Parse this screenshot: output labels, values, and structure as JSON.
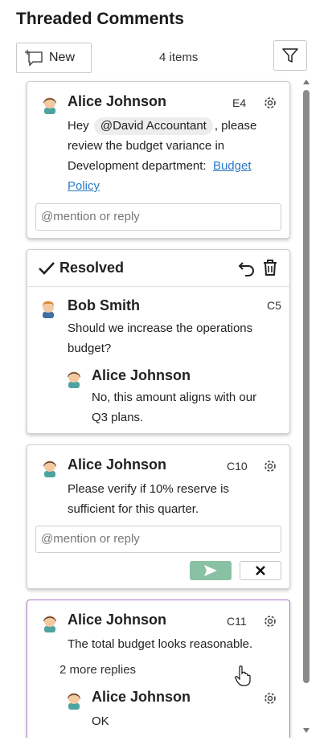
{
  "panel": {
    "title": "Threaded Comments",
    "new_label": "New",
    "item_count": "4 items"
  },
  "threads": [
    {
      "author": "Alice Johnson",
      "cell": "E4",
      "text_before": "Hey",
      "mention": "@David Accountant",
      "text_after_1": ", please",
      "text_line2": "review the budget variance in",
      "text_line3": "Development department:",
      "link_part1": "Budget",
      "link_part2": "Policy",
      "reply_placeholder": "@mention or reply"
    },
    {
      "resolved_label": "Resolved",
      "author": "Bob Smith",
      "cell": "C5",
      "text_line1": "Should we increase the operations",
      "text_line2": "budget?",
      "reply": {
        "author": "Alice Johnson",
        "text_line1": "No, this amount aligns with our",
        "text_line2": "Q3 plans."
      }
    },
    {
      "author": "Alice Johnson",
      "cell": "C10",
      "text_line1": "Please verify if 10% reserve is",
      "text_line2": "sufficient for this quarter.",
      "reply_placeholder": "@mention or reply"
    },
    {
      "author": "Alice Johnson",
      "cell": "C11",
      "text_line1": "The total budget looks reasonable.",
      "more_replies": "2 more replies",
      "reply": {
        "author": "Alice Johnson",
        "text_line1": "OK"
      }
    }
  ],
  "icons": {
    "new": "new-comment-icon",
    "filter": "filter-icon",
    "gear": "gear-icon",
    "check": "checkmark-icon",
    "reopen": "reopen-icon",
    "delete": "trash-icon",
    "send": "send-icon",
    "cancel": "close-icon"
  },
  "colors": {
    "send_button": "#88c1a4",
    "selected_border": "#b07cc6",
    "link": "#2a78c6"
  }
}
